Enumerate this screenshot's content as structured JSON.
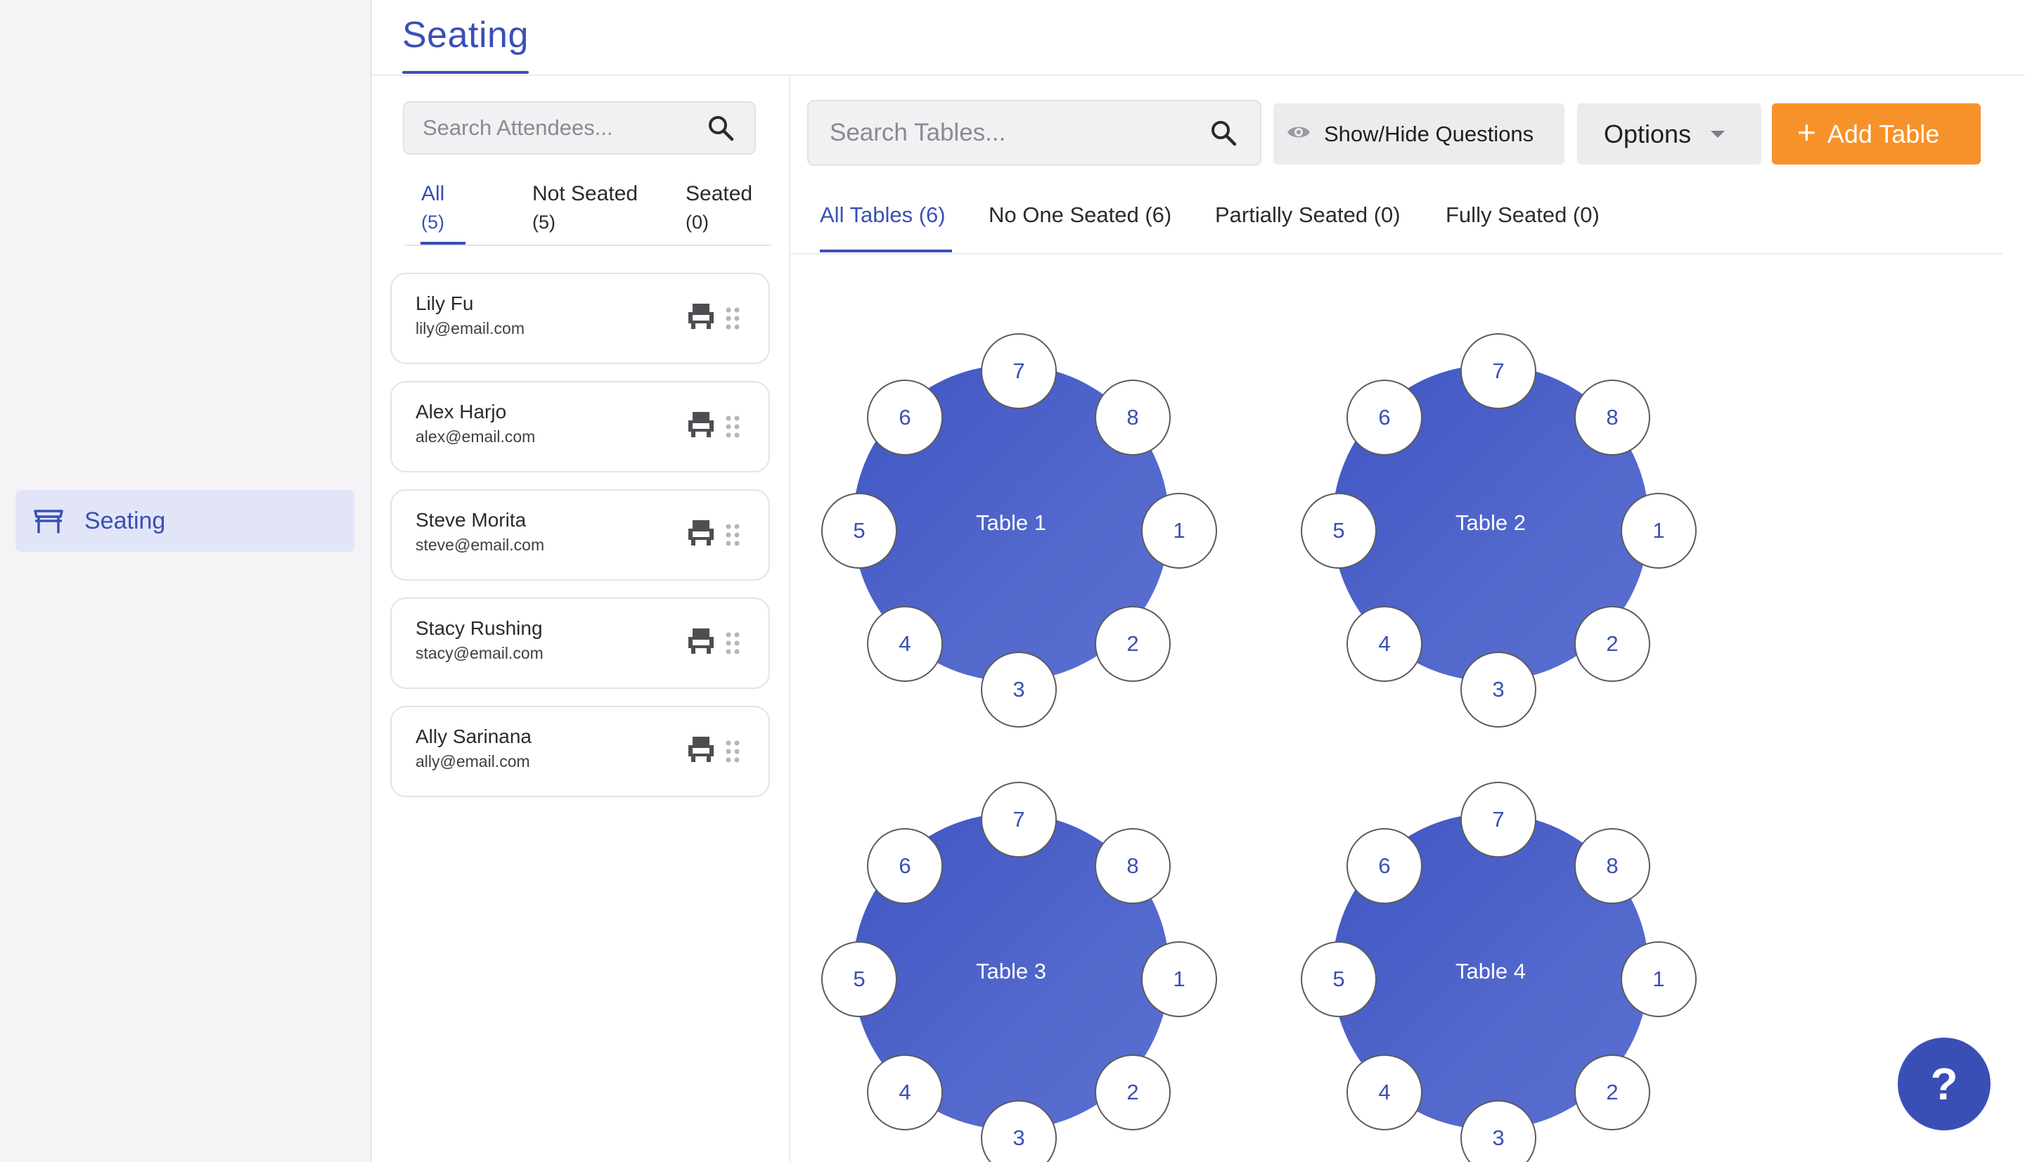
{
  "nav": {
    "items": [
      {
        "label": "Seating",
        "icon": "table-icon",
        "active": true
      }
    ]
  },
  "header": {
    "title": "Seating"
  },
  "attendees": {
    "search_placeholder": "Search Attendees...",
    "tabs": [
      {
        "label": "All",
        "count": "(5)",
        "active": true
      },
      {
        "label": "Not Seated",
        "count": "(5)"
      },
      {
        "label": "Seated",
        "count": "(0)"
      }
    ],
    "list": [
      {
        "name": "Lily Fu",
        "email": "lily@email.com"
      },
      {
        "name": "Alex Harjo",
        "email": "alex@email.com"
      },
      {
        "name": "Steve Morita",
        "email": "steve@email.com"
      },
      {
        "name": "Stacy Rushing",
        "email": "stacy@email.com"
      },
      {
        "name": "Ally Sarinana",
        "email": "ally@email.com"
      }
    ]
  },
  "toolbar": {
    "search_placeholder": "Search Tables...",
    "show_hide_label": "Show/Hide Questions",
    "options_label": "Options",
    "add_table_label": "Add Table",
    "add_table_plus": "+"
  },
  "table_tabs": [
    {
      "label": "All Tables (6)",
      "active": true
    },
    {
      "label": "No One Seated (6)"
    },
    {
      "label": "Partially Seated (0)"
    },
    {
      "label": "Fully Seated (0)"
    }
  ],
  "tables": [
    {
      "name": "Table 1",
      "seats": [
        "1",
        "2",
        "3",
        "4",
        "5",
        "6",
        "7",
        "8"
      ]
    },
    {
      "name": "Table 2",
      "seats": [
        "1",
        "2",
        "3",
        "4",
        "5",
        "6",
        "7",
        "8"
      ]
    },
    {
      "name": "Table 3",
      "seats": [
        "1",
        "2",
        "3",
        "4",
        "5",
        "6",
        "7",
        "8"
      ]
    },
    {
      "name": "Table 4",
      "seats": [
        "1",
        "2",
        "3",
        "4",
        "5",
        "6",
        "7",
        "8"
      ]
    }
  ],
  "help": {
    "label": "?"
  },
  "colors": {
    "accent": "#3a4fb5",
    "add_button": "#f7922a",
    "table_fill": "#4a5fc8"
  }
}
